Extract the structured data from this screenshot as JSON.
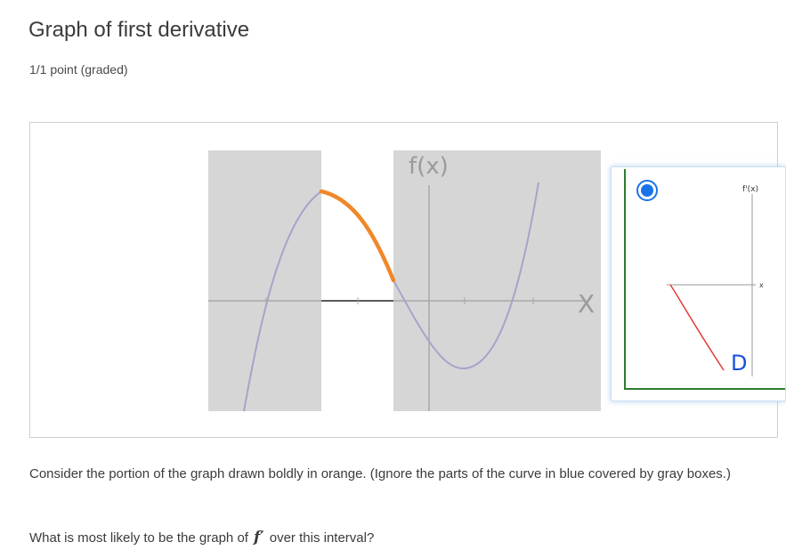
{
  "header": {
    "title": "Graph of first derivative",
    "points": "1/1 point (graded)"
  },
  "figure": {
    "function_label": "f(x)",
    "x_axis_label": "X",
    "colors": {
      "curve": "#a5a4c9",
      "highlight": "#f0882a",
      "gray_box": "#d6d6d6",
      "axis": "#a8a8a8"
    }
  },
  "option": {
    "selected": true,
    "graph_label": "f'(x)",
    "x_label": "x",
    "letter": "D",
    "colors": {
      "curve": "#e53935",
      "frame": "#2e7d32",
      "radio": "#1a73e8",
      "letter": "#1a4fe0"
    }
  },
  "question": {
    "text": "Consider the portion of the graph drawn boldly in orange. (Ignore the parts of the curve in blue covered by gray boxes.)",
    "prompt_before": "What is most likely to be the graph of",
    "math_symbol": "f′",
    "prompt_after": "over this interval?"
  }
}
